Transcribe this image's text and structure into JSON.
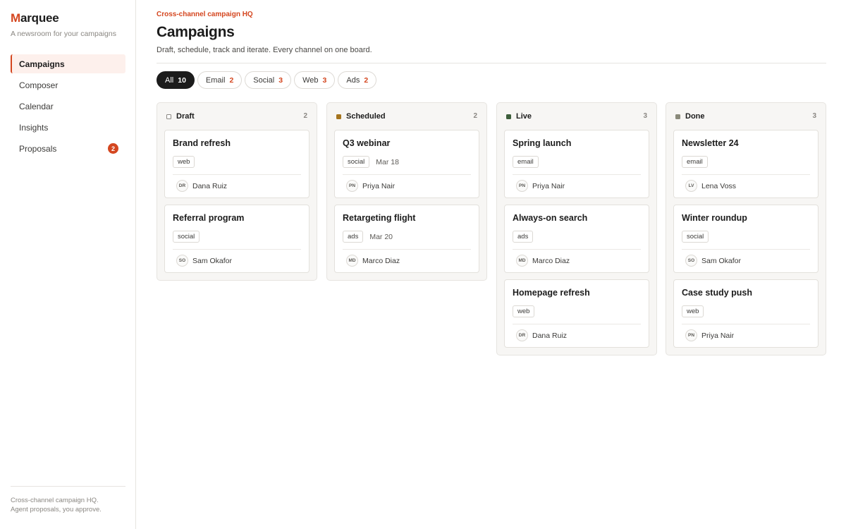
{
  "brand": {
    "first_letter": "M",
    "rest": "arquee",
    "tagline": "A newsroom for your campaigns"
  },
  "sidebar": {
    "items": [
      {
        "label": "Campaigns",
        "active": true
      },
      {
        "label": "Composer"
      },
      {
        "label": "Calendar"
      },
      {
        "label": "Insights"
      },
      {
        "label": "Proposals",
        "badge": "2"
      }
    ],
    "footer_line1": "Cross-channel campaign HQ.",
    "footer_line2": "Agent proposals, you approve."
  },
  "header": {
    "eyebrow": "Cross-channel campaign HQ",
    "title": "Campaigns",
    "subtitle": "Draft, schedule, track and iterate. Every channel on one board."
  },
  "filters": [
    {
      "label": "All",
      "count": "10",
      "active": true
    },
    {
      "label": "Email",
      "count": "2"
    },
    {
      "label": "Social",
      "count": "3"
    },
    {
      "label": "Web",
      "count": "3"
    },
    {
      "label": "Ads",
      "count": "2"
    }
  ],
  "columns": [
    {
      "name": "Draft",
      "count": "2",
      "dot_color": "#ffffff",
      "dot_border": "#8a8782",
      "cards": [
        {
          "title": "Brand refresh",
          "tag": "web",
          "date": "",
          "initials": "DR",
          "owner": "Dana Ruiz"
        },
        {
          "title": "Referral program",
          "tag": "social",
          "date": "",
          "initials": "SO",
          "owner": "Sam Okafor"
        }
      ]
    },
    {
      "name": "Scheduled",
      "count": "2",
      "dot_color": "#a5741e",
      "dot_border": "#a5741e",
      "cards": [
        {
          "title": "Q3 webinar",
          "tag": "social",
          "date": "Mar 18",
          "initials": "PN",
          "owner": "Priya Nair"
        },
        {
          "title": "Retargeting flight",
          "tag": "ads",
          "date": "Mar 20",
          "initials": "MD",
          "owner": "Marco Diaz"
        }
      ]
    },
    {
      "name": "Live",
      "count": "3",
      "dot_color": "#3d5e3b",
      "dot_border": "#3d5e3b",
      "cards": [
        {
          "title": "Spring launch",
          "tag": "email",
          "date": "",
          "initials": "PN",
          "owner": "Priya Nair"
        },
        {
          "title": "Always-on search",
          "tag": "ads",
          "date": "",
          "initials": "MD",
          "owner": "Marco Diaz"
        },
        {
          "title": "Homepage refresh",
          "tag": "web",
          "date": "",
          "initials": "DR",
          "owner": "Dana Ruiz"
        }
      ]
    },
    {
      "name": "Done",
      "count": "3",
      "dot_color": "#8a8a7a",
      "dot_border": "#8a8a7a",
      "cards": [
        {
          "title": "Newsletter 24",
          "tag": "email",
          "date": "",
          "initials": "LV",
          "owner": "Lena Voss"
        },
        {
          "title": "Winter roundup",
          "tag": "social",
          "date": "",
          "initials": "SO",
          "owner": "Sam Okafor"
        },
        {
          "title": "Case study push",
          "tag": "web",
          "date": "",
          "initials": "PN",
          "owner": "Priya Nair"
        }
      ]
    }
  ],
  "colors": {
    "accent": "#d4461f",
    "ink": "#1c1c1c"
  }
}
